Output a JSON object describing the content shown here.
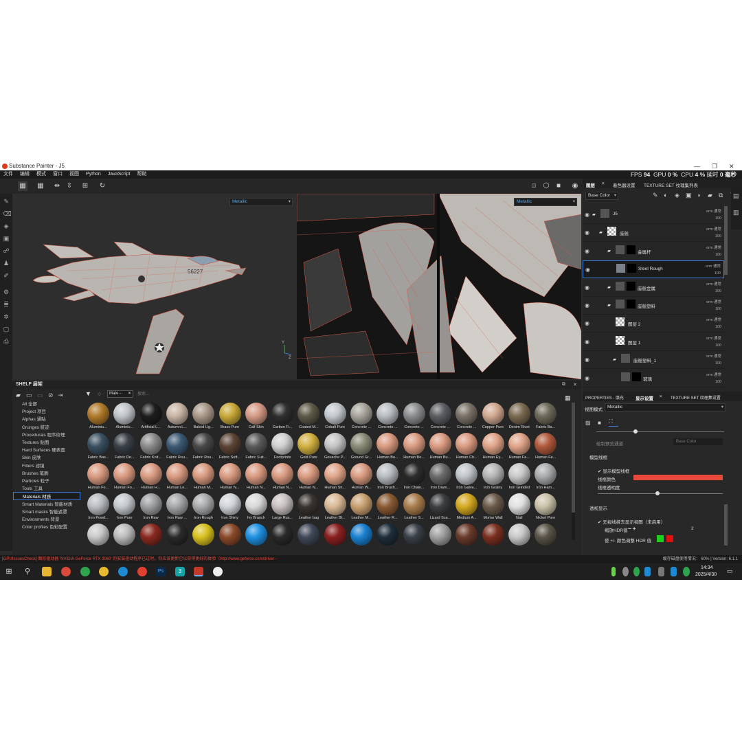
{
  "window": {
    "title": "Substance Painter - J5"
  },
  "menu": [
    "文件",
    "编辑",
    "模式",
    "窗口",
    "视图",
    "Python",
    "JavaScript",
    "帮助"
  ],
  "perf": {
    "fps_label": "FPS",
    "fps": "94",
    "gpu_label": "GPU",
    "gpu": "0 %",
    "cpu_label": "CPU",
    "cpu": "4 %",
    "latency_label": "延时",
    "latency": "0 毫秒"
  },
  "viewport3d": {
    "channel": "Metallic",
    "aircraft_code": "56227"
  },
  "viewport2d": {
    "channel": "Metallic"
  },
  "shelf": {
    "title": "SHELF 层架",
    "filter_chip": "Mate···",
    "search_placeholder": "搜索...",
    "categories": [
      "All 全部",
      "Project 项目",
      "Alphas 通贴",
      "Grunges 脏迹",
      "Procedurals 程序纹理",
      "Textures 贴图",
      "Hard Surfaces 硬表面",
      "Skin 皮肤",
      "Filters 滤镜",
      "Brushes 笔刷",
      "Particles 粒子",
      "Tools 工具",
      "Materials 材质",
      "Smart Materials 智能材质",
      "Smart masks 智能遮罩",
      "Environments 背景",
      "Color profiles 色彩配置"
    ],
    "selected_category": "Materials 材质",
    "materials": [
      {
        "label": "Aluminiu...",
        "color": "#b07a2a"
      },
      {
        "label": "Aluminiu...",
        "color": "#c0c4c8"
      },
      {
        "label": "Artificial L...",
        "color": "#1e1e1e"
      },
      {
        "label": "Autumn L...",
        "color": "#c8b4a4"
      },
      {
        "label": "Baked Lig...",
        "color": "#a89888"
      },
      {
        "label": "Brass Pure",
        "color": "#c8a838"
      },
      {
        "label": "Calf Skin",
        "color": "#d49a84"
      },
      {
        "label": "Carbon Fi...",
        "color": "#303030"
      },
      {
        "label": "Coated M...",
        "color": "#5e5a48"
      },
      {
        "label": "Cobalt Pure",
        "color": "#c4c8cc"
      },
      {
        "label": "Concrete ...",
        "color": "#a8a49c"
      },
      {
        "label": "Concrete ...",
        "color": "#b8bcc0"
      },
      {
        "label": "Concrete ...",
        "color": "#8a8c8e"
      },
      {
        "label": "Concrete ...",
        "color": "#5c5e62"
      },
      {
        "label": "Concrete ...",
        "color": "#7a7268"
      },
      {
        "label": "Copper Pure",
        "color": "#d0a890"
      },
      {
        "label": "Denim Rivet",
        "color": "#7a6a50"
      },
      {
        "label": "Fabric Ba...",
        "color": "#6e6a5a"
      },
      {
        "label": "Fabric Bas...",
        "color": "#3a5060"
      },
      {
        "label": "Fabric De...",
        "color": "#3a4048"
      },
      {
        "label": "Fabric Knit...",
        "color": "#8a8a8a"
      },
      {
        "label": "Fabric Rou...",
        "color": "#3c5a74"
      },
      {
        "label": "Fabric Rou...",
        "color": "#484848"
      },
      {
        "label": "Fabric Soft...",
        "color": "#5c4436"
      },
      {
        "label": "Fabric Suit...",
        "color": "#5a5a5a"
      },
      {
        "label": "Footprints",
        "color": "#cfcfcf"
      },
      {
        "label": "Gold Pure",
        "color": "#d2b040"
      },
      {
        "label": "Gouache P...",
        "color": "#c4c4c4"
      },
      {
        "label": "Ground Gr...",
        "color": "#8a8a78"
      },
      {
        "label": "Human Ba...",
        "color": "#d99a80"
      },
      {
        "label": "Human Be...",
        "color": "#d99a80"
      },
      {
        "label": "Human Bu...",
        "color": "#d99a80"
      },
      {
        "label": "Human Ch...",
        "color": "#d99a80"
      },
      {
        "label": "Human Ey...",
        "color": "#e0a488"
      },
      {
        "label": "Human Fa...",
        "color": "#e0a488"
      },
      {
        "label": "Human Fe...",
        "color": "#b05a3c"
      },
      {
        "label": "Human Fo...",
        "color": "#d99a80"
      },
      {
        "label": "Human Fo...",
        "color": "#d99a80"
      },
      {
        "label": "Human H...",
        "color": "#d99a80"
      },
      {
        "label": "Human Le...",
        "color": "#d99a80"
      },
      {
        "label": "Human M...",
        "color": "#d99a80"
      },
      {
        "label": "Human N...",
        "color": "#d99a80"
      },
      {
        "label": "Human N...",
        "color": "#d99a80"
      },
      {
        "label": "Human N...",
        "color": "#d99a80"
      },
      {
        "label": "Human N...",
        "color": "#d99a80"
      },
      {
        "label": "Human Sh...",
        "color": "#e0a488"
      },
      {
        "label": "Human W...",
        "color": "#d99a80"
      },
      {
        "label": "Iron Brush...",
        "color": "#b8bcc0"
      },
      {
        "label": "Iron Chain...",
        "color": "#2c2c2c"
      },
      {
        "label": "Iron Diam...",
        "color": "#6a6a6a"
      },
      {
        "label": "Iron Galva...",
        "color": "#c0c4c8"
      },
      {
        "label": "Iron Grainy",
        "color": "#b4b4b4"
      },
      {
        "label": "Iron Grinded",
        "color": "#c8c8c8"
      },
      {
        "label": "Iron Ham...",
        "color": "#a8aaac"
      },
      {
        "label": "Iron Powd...",
        "color": "#b8bcc0"
      },
      {
        "label": "Iron Pure",
        "color": "#c4c8cc"
      },
      {
        "label": "Iron Raw",
        "color": "#9c9ea0"
      },
      {
        "label": "Iron Raw ...",
        "color": "#a4a6a8"
      },
      {
        "label": "Iron Rough",
        "color": "#a8aaac"
      },
      {
        "label": "Iron Shiny",
        "color": "#d0d4d8"
      },
      {
        "label": "Ivy Branch",
        "color": "#d8d8d8"
      },
      {
        "label": "Large Rus...",
        "color": "#c8c0c0"
      },
      {
        "label": "Leather bag",
        "color": "#3a3430"
      },
      {
        "label": "Leather Bl...",
        "color": "#d8b894"
      },
      {
        "label": "Leather M...",
        "color": "#c8a070"
      },
      {
        "label": "Leather R...",
        "color": "#8a5a34"
      },
      {
        "label": "Leather S...",
        "color": "#a87c4c"
      },
      {
        "label": "Lizard Sca...",
        "color": "#3c3e40"
      },
      {
        "label": "Medium A...",
        "color": "#d4a820"
      },
      {
        "label": "Mortar Wall",
        "color": "#6a5a4a"
      },
      {
        "label": "Nail",
        "color": "#e0e0e0"
      },
      {
        "label": "Nickel Pure",
        "color": "#c8c0a8"
      },
      {
        "label": "",
        "color": "#c8c8c8"
      },
      {
        "label": "",
        "color": "#bcbcbc"
      },
      {
        "label": "",
        "color": "#8a2a20"
      },
      {
        "label": "",
        "color": "#2a2a2a"
      },
      {
        "label": "",
        "color": "#d8c020"
      },
      {
        "label": "",
        "color": "#8a4a2a"
      },
      {
        "label": "",
        "color": "#1e90e0"
      },
      {
        "label": "",
        "color": "#2a2a2a"
      },
      {
        "label": "",
        "color": "#404858"
      },
      {
        "label": "",
        "color": "#8a2020"
      },
      {
        "label": "",
        "color": "#1a80d0"
      },
      {
        "label": "",
        "color": "#1e2e3a"
      },
      {
        "label": "",
        "color": "#3a4048"
      },
      {
        "label": "",
        "color": "#a0a0a0"
      },
      {
        "label": "",
        "color": "#6a3a2a"
      },
      {
        "label": "",
        "color": "#7a3020"
      },
      {
        "label": "",
        "color": "#c8c8c8"
      },
      {
        "label": "",
        "color": "#5a5448"
      }
    ]
  },
  "layers_panel": {
    "tab_layers": "图层",
    "tab_bake": "着色器设置",
    "tab_texset": "TEXTURE SET 纹理集列表",
    "channel": "Base Color",
    "layers": [
      {
        "name": "J5",
        "mode": "orm 通常",
        "opacity": "100",
        "kind": "folder"
      },
      {
        "name": "座舱",
        "mode": "orm 通常",
        "opacity": "100",
        "kind": "checker"
      },
      {
        "name": "金属杆",
        "mode": "orm 通常",
        "opacity": "100",
        "kind": "fill"
      },
      {
        "name": "Steel Rough",
        "mode": "orm 通常",
        "opacity": "100",
        "kind": "selected"
      },
      {
        "name": "座舱金属",
        "mode": "orm 通常",
        "opacity": "100",
        "kind": "fill"
      },
      {
        "name": "座舱塑料",
        "mode": "orm 通常",
        "opacity": "100",
        "kind": "fill"
      },
      {
        "name": "图层 2",
        "mode": "orm 通常",
        "opacity": "100",
        "kind": "checker"
      },
      {
        "name": "图层 1",
        "mode": "orm 通常",
        "opacity": "100",
        "kind": "checker"
      },
      {
        "name": "座舱塑料_1",
        "mode": "orm 通常",
        "opacity": "100",
        "kind": "folder"
      },
      {
        "name": "玻璃",
        "mode": "orm 通常",
        "opacity": "100",
        "kind": "fill"
      }
    ]
  },
  "properties": {
    "tab_props": "PROPERTIES - 填充",
    "tab_display": "显示设置",
    "tab_texset": "TEXTURE SET 纹理集设置",
    "view_mode_label": "视图模式",
    "view_mode": "Metallic",
    "base_color_field": "Base Color",
    "base_color_label": "绘制预览通道",
    "wireframe_section": "模型线框",
    "show_wireframe": "显示模型线框",
    "wire_color": "线框颜色",
    "wire_opacity": "线框透明度",
    "transparency_section": "透视显示",
    "iso_label": "无视线抹去显示视图（未启用）",
    "stepper_label": "缩放HDR值",
    "stepper_value": "2",
    "hdr_label": "使 +/- 颜色调整 HDR 值",
    "accent_red": "#e8493a",
    "swatch_green": "#19d219",
    "swatch_red": "#e01010"
  },
  "status": {
    "message": "[GPUIssuesCheck] 图形驱动器  'NVIDIA GeForce RTX 3060'  的安装驱动程序已过时。你应该更新它以获得更好的体验（http://www.geforce.com/driver···",
    "right": "缓存磁盘使用情况： 60% | Version: 6.1.1"
  },
  "taskbar": {
    "time": "14:34",
    "date": "2025/4/30"
  }
}
